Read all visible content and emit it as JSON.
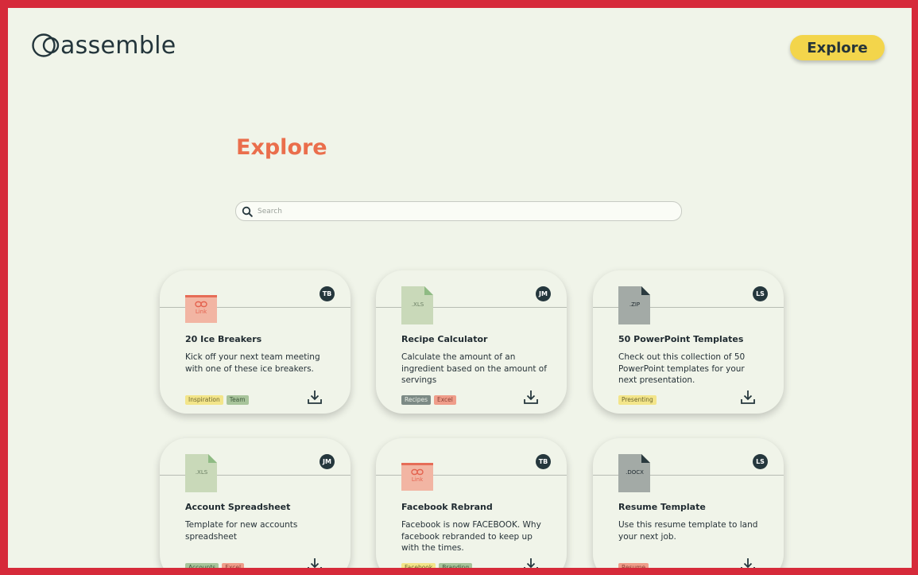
{
  "brand": {
    "name": "assemble"
  },
  "header": {
    "explore_label": "Explore"
  },
  "page": {
    "title": "Explore"
  },
  "search": {
    "placeholder": "Search",
    "value": ""
  },
  "colors": {
    "accent_yellow": "#f3d54b",
    "title_orange": "#ea6e4c",
    "background": "#f0f4e9",
    "border_red": "#d62a3a"
  },
  "cards": [
    {
      "title": "20 Ice Breakers",
      "description": "Kick off your next team meeting with one of these ice breakers.",
      "avatar": "TB",
      "thumb_type": "link",
      "thumb_label": "Link",
      "tags": [
        {
          "label": "Inspiration",
          "bg": "#f3e58a",
          "fg": "#6d6630"
        },
        {
          "label": "Team",
          "bg": "#a8c49b",
          "fg": "#3f5a3c"
        }
      ]
    },
    {
      "title": "Recipe Calculator",
      "description": "Calculate the amount of an ingredient based on the amount of servings",
      "avatar": "JM",
      "thumb_type": "file",
      "thumb_label": ".XLS",
      "file_color": "#c9d9b9",
      "corner_color": "#8fbb84",
      "label_color": "#6b7f64",
      "tags": [
        {
          "label": "Recipes",
          "bg": "#7c8a85",
          "fg": "#e9eee6"
        },
        {
          "label": "Excel",
          "bg": "#ef9d8a",
          "fg": "#8a3f34"
        }
      ]
    },
    {
      "title": "50 PowerPoint Templates",
      "description": "Check out this collection of 50 PowerPoint templates for your next presentation.",
      "avatar": "LS",
      "thumb_type": "file",
      "thumb_label": ".ZIP",
      "file_color": "#a3aaa6",
      "corner_color": "#2a3a3f",
      "label_color": "#1f2a30",
      "tags": [
        {
          "label": "Presenting",
          "bg": "#f3e58a",
          "fg": "#6d6630"
        }
      ]
    },
    {
      "title": "Account Spreadsheet",
      "description": "Template for new accounts spreadsheet",
      "avatar": "JM",
      "thumb_type": "file",
      "thumb_label": ".XLS",
      "file_color": "#c9d9b9",
      "corner_color": "#8fbb84",
      "label_color": "#6b7f64",
      "tags": [
        {
          "label": "Accounts",
          "bg": "#a8c49b",
          "fg": "#3f5a3c"
        },
        {
          "label": "Excel",
          "bg": "#ef9d8a",
          "fg": "#8a3f34"
        }
      ]
    },
    {
      "title": "Facebook Rebrand",
      "description": "Facebook is now FACEBOOK. Why facebook rebranded to keep up with the times.",
      "avatar": "TB",
      "thumb_type": "link",
      "thumb_label": "Link",
      "tags": [
        {
          "label": "Facebook",
          "bg": "#f3e58a",
          "fg": "#6d6630"
        },
        {
          "label": "Branding",
          "bg": "#a8c49b",
          "fg": "#3f5a3c"
        }
      ]
    },
    {
      "title": "Resume Template",
      "description": "Use this resume template to land your next job.",
      "avatar": "LS",
      "thumb_type": "file",
      "thumb_label": ".DOCX",
      "file_color": "#a3aaa6",
      "corner_color": "#2a3a3f",
      "label_color": "#1f2a30",
      "tags": [
        {
          "label": "Resume",
          "bg": "#ef9d8a",
          "fg": "#8a3f34"
        }
      ]
    }
  ]
}
